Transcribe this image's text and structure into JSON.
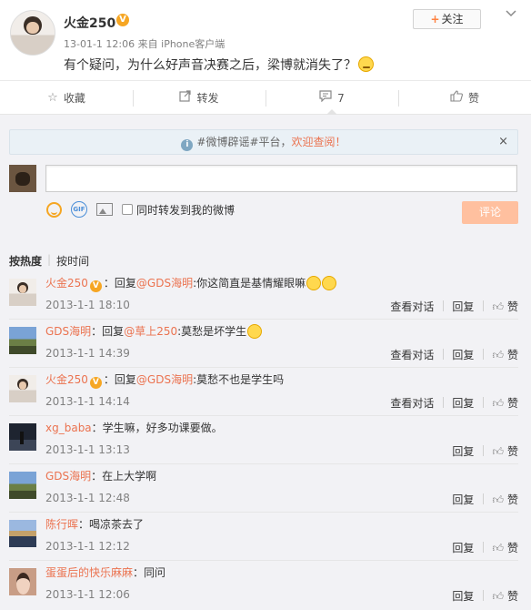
{
  "post": {
    "author": "火金250",
    "verified_badge": "V",
    "timestamp": "13-01-1 12:06",
    "source": "来自 iPhone客户端",
    "text": "有个疑问，为什么好声音决赛之后，梁博就消失了？",
    "follow_label": "关注",
    "follow_plus": "+",
    "menu_icon": "chevron-down-icon"
  },
  "actions": {
    "favorite": "收藏",
    "forward": "转发",
    "comment_count": "7",
    "like": "赞"
  },
  "notice": {
    "text": "#微博辟谣#平台，",
    "link": "欢迎查阅！",
    "close": "×"
  },
  "composer": {
    "value": "",
    "also_forward_label": "同时转发到我的微博",
    "submit_label": "评论",
    "gif_label": "GIF"
  },
  "sort": {
    "by_hot": "按热度",
    "by_time": "按时间",
    "separator": "|"
  },
  "comments": [
    {
      "name": "火金250",
      "verified": true,
      "prefix": "：回复",
      "mention": "@GDS海明",
      "text": ":你这简直是基情耀眼嘛",
      "time": "2013-1-1 18:10",
      "view_conv": "查看对话",
      "reply": "回复",
      "like": "赞"
    },
    {
      "name": "GDS海明",
      "verified": false,
      "prefix": "：回复",
      "mention": "@草上250",
      "text": ":莫愁是坏学生",
      "time": "2013-1-1 14:39",
      "view_conv": "查看对话",
      "reply": "回复",
      "like": "赞"
    },
    {
      "name": "火金250",
      "verified": true,
      "prefix": "：回复",
      "mention": "@GDS海明",
      "text": ":莫愁不也是学生吗",
      "time": "2013-1-1 14:14",
      "view_conv": "查看对话",
      "reply": "回复",
      "like": "赞"
    },
    {
      "name": "xg_baba",
      "verified": false,
      "prefix": "",
      "mention": "",
      "text": "：学生嘛，好多功课要做。",
      "time": "2013-1-1 13:13",
      "reply": "回复",
      "like": "赞"
    },
    {
      "name": "GDS海明",
      "verified": false,
      "prefix": "",
      "mention": "",
      "text": "：在上大学啊",
      "time": "2013-1-1 12:48",
      "reply": "回复",
      "like": "赞"
    },
    {
      "name": "陈行晖",
      "verified": false,
      "prefix": "",
      "mention": "",
      "text": "：喝凉茶去了",
      "time": "2013-1-1 12:12",
      "reply": "回复",
      "like": "赞"
    },
    {
      "name": "蛋蛋后的快乐麻麻",
      "verified": false,
      "prefix": "",
      "mention": "",
      "text": "：同问",
      "time": "2013-1-1 12:06",
      "reply": "回复",
      "like": "赞"
    }
  ]
}
